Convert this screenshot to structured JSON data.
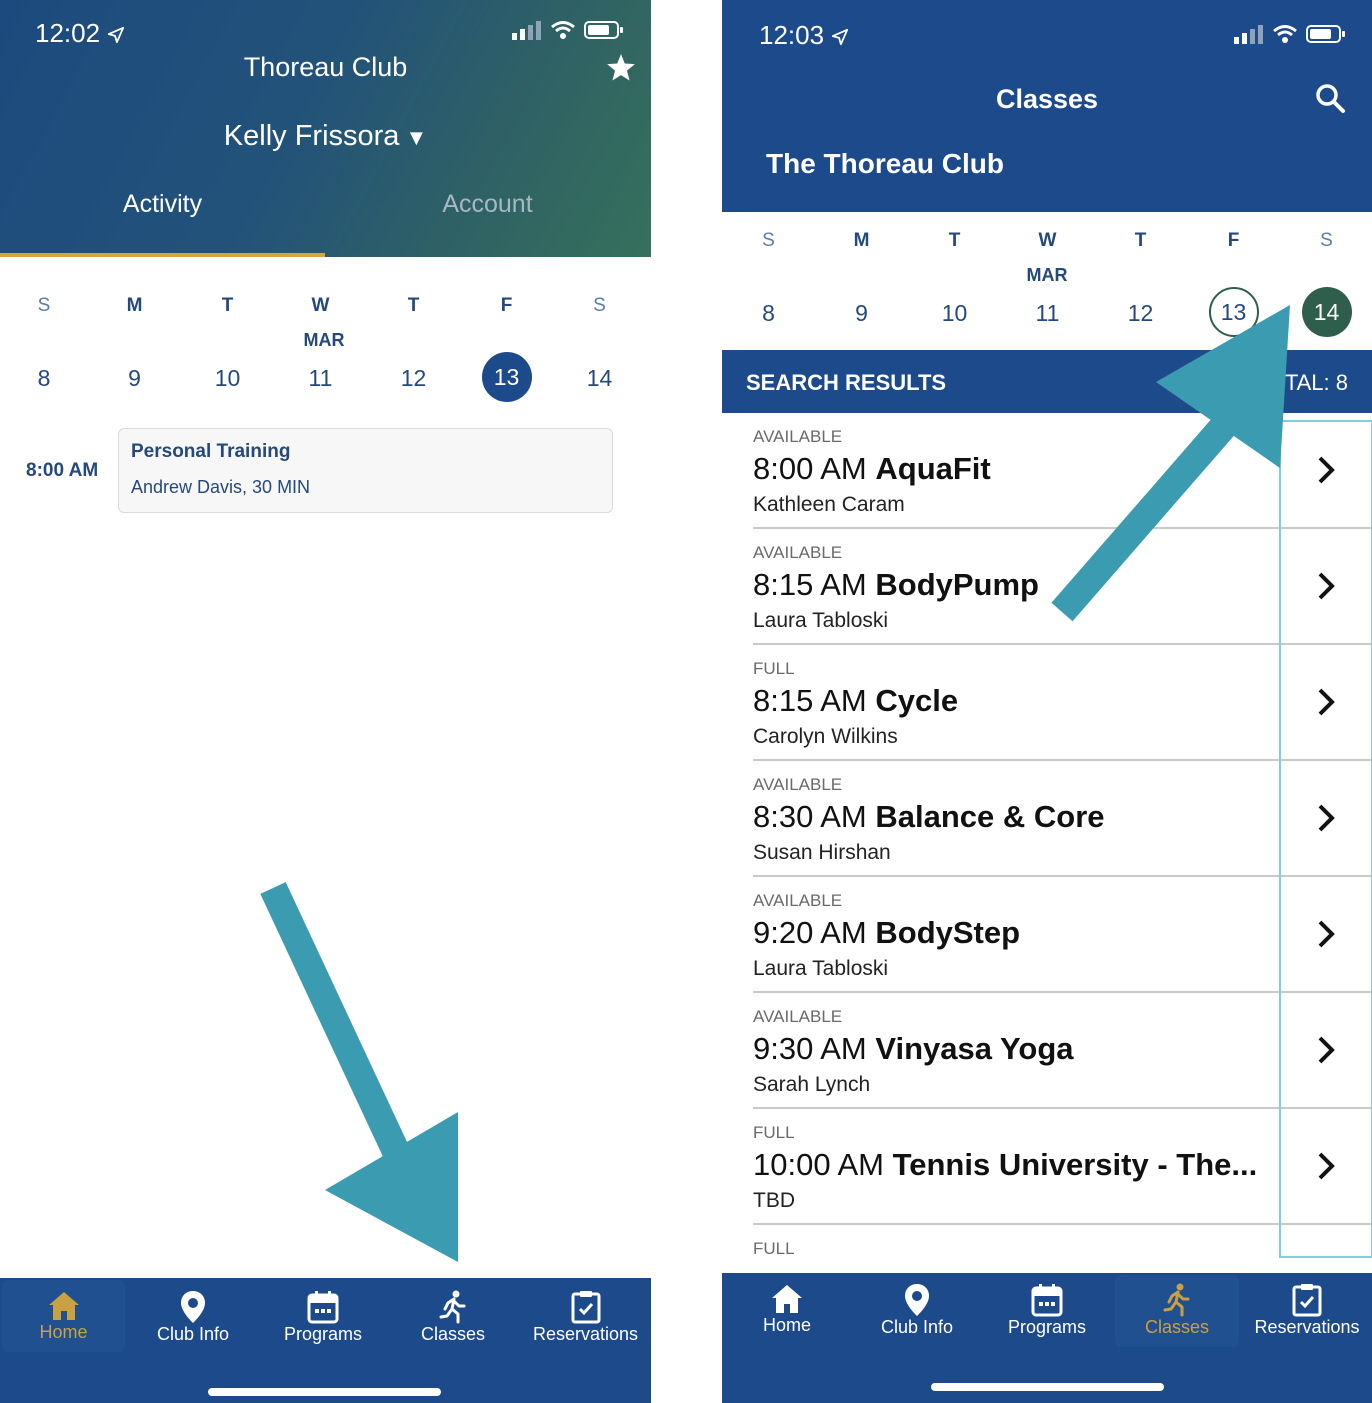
{
  "colors": {
    "navy": "#1c4a8a",
    "accent_gold": "#c9a042",
    "arrow_teal": "#3a9bb1",
    "selected_day_green": "#2f5f4c"
  },
  "left": {
    "status": {
      "time": "12:02",
      "location_icon": "location-arrow-icon",
      "icons": [
        "signal-icon",
        "wifi-icon",
        "battery-icon"
      ]
    },
    "header": {
      "title": "Thoreau Club",
      "favorite_icon": "star-icon",
      "user_name": "Kelly Frissora",
      "user_caret": "▼"
    },
    "tabs": [
      {
        "label": "Activity",
        "active": true
      },
      {
        "label": "Account",
        "active": false
      }
    ],
    "calendar": {
      "month": "MAR",
      "days": [
        {
          "dow": "S",
          "num": "8"
        },
        {
          "dow": "M",
          "num": "9"
        },
        {
          "dow": "T",
          "num": "10"
        },
        {
          "dow": "W",
          "num": "11"
        },
        {
          "dow": "T",
          "num": "12"
        },
        {
          "dow": "F",
          "num": "13",
          "selected": true
        },
        {
          "dow": "S",
          "num": "14"
        }
      ]
    },
    "activity": {
      "time": "8:00 AM",
      "title": "Personal Training",
      "subtitle": "Andrew Davis, 30 MIN"
    },
    "tabbar": [
      {
        "label": "Home",
        "icon": "home-icon",
        "active": true
      },
      {
        "label": "Club Info",
        "icon": "map-pin-icon",
        "active": false
      },
      {
        "label": "Programs",
        "icon": "calendar-icon",
        "active": false
      },
      {
        "label": "Classes",
        "icon": "running-icon",
        "active": false
      },
      {
        "label": "Reservations",
        "icon": "clipboard-check-icon",
        "active": false
      }
    ]
  },
  "right": {
    "status": {
      "time": "12:03",
      "location_icon": "location-arrow-icon"
    },
    "header": {
      "title": "Classes",
      "search_icon": "search-icon",
      "club_name": "The Thoreau Club"
    },
    "calendar": {
      "month": "MAR",
      "days": [
        {
          "dow": "S",
          "num": "8"
        },
        {
          "dow": "M",
          "num": "9"
        },
        {
          "dow": "T",
          "num": "10"
        },
        {
          "dow": "W",
          "num": "11"
        },
        {
          "dow": "T",
          "num": "12"
        },
        {
          "dow": "F",
          "num": "13",
          "today": true
        },
        {
          "dow": "S",
          "num": "14",
          "selected": true
        }
      ]
    },
    "results": {
      "label": "SEARCH RESULTS",
      "total": "TAL: 8"
    },
    "classes": [
      {
        "status": "AVAILABLE",
        "time": "8:00 AM",
        "name": "AquaFit",
        "instructor": "Kathleen Caram"
      },
      {
        "status": "AVAILABLE",
        "time": "8:15 AM",
        "name": "BodyPump",
        "instructor": "Laura Tabloski"
      },
      {
        "status": "FULL",
        "time": "8:15 AM",
        "name": "Cycle",
        "instructor": "Carolyn Wilkins"
      },
      {
        "status": "AVAILABLE",
        "time": "8:30 AM",
        "name": "Balance & Core",
        "instructor": "Susan Hirshan"
      },
      {
        "status": "AVAILABLE",
        "time": "9:20 AM",
        "name": "BodyStep",
        "instructor": "Laura Tabloski"
      },
      {
        "status": "AVAILABLE",
        "time": "9:30 AM",
        "name": "Vinyasa Yoga",
        "instructor": "Sarah Lynch"
      },
      {
        "status": "FULL",
        "time": "10:00 AM",
        "name": "Tennis University - The...",
        "instructor": "TBD"
      },
      {
        "status": "FULL",
        "time": "",
        "name": "",
        "instructor": ""
      }
    ],
    "tabbar": [
      {
        "label": "Home",
        "icon": "home-icon",
        "active": false
      },
      {
        "label": "Club Info",
        "icon": "map-pin-icon",
        "active": false
      },
      {
        "label": "Programs",
        "icon": "calendar-icon",
        "active": false
      },
      {
        "label": "Classes",
        "icon": "running-icon",
        "active": true
      },
      {
        "label": "Reservations",
        "icon": "clipboard-check-icon",
        "active": false
      }
    ]
  }
}
